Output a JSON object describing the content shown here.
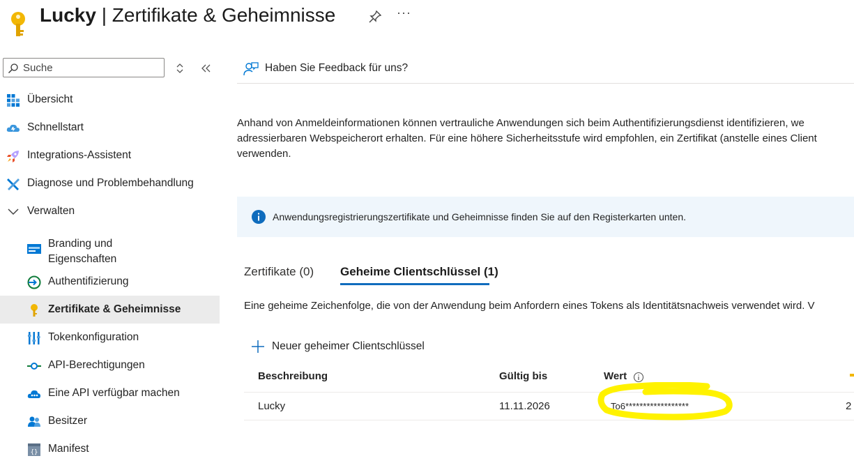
{
  "header": {
    "app_name": "Lucky",
    "separator": " | ",
    "page_title": "Zertifikate & Geheimnisse",
    "more_label": "···"
  },
  "sidebar": {
    "search_placeholder": "Suche",
    "items": [
      {
        "label": "Übersicht",
        "icon": "grid-icon"
      },
      {
        "label": "Schnellstart",
        "icon": "cloud-icon"
      },
      {
        "label": "Integrations-Assistent",
        "icon": "rocket-icon"
      },
      {
        "label": "Diagnose und Problembehandlung",
        "icon": "tools-icon"
      },
      {
        "label": "Verwalten",
        "icon": "chevron-down-icon"
      },
      {
        "label": "Branding und Eigenschaften",
        "icon": "branding-icon"
      },
      {
        "label": "Authentifizierung",
        "icon": "auth-icon"
      },
      {
        "label": "Zertifikate & Geheimnisse",
        "icon": "key-icon"
      },
      {
        "label": "Tokenkonfiguration",
        "icon": "token-icon"
      },
      {
        "label": "API-Berechtigungen",
        "icon": "api-permission-icon"
      },
      {
        "label": "Eine API verfügbar machen",
        "icon": "cloud-api-icon"
      },
      {
        "label": "Besitzer",
        "icon": "owners-icon"
      },
      {
        "label": "Manifest",
        "icon": "manifest-icon"
      }
    ]
  },
  "main": {
    "feedback_label": "Haben Sie Feedback für uns?",
    "description_lines": [
      "Anhand von Anmeldeinformationen können vertrauliche Anwendungen sich beim Authentifizierungsdienst identifizieren, we",
      "adressierbaren Webspeicherort erhalten. Für eine höhere Sicherheitsstufe wird empfohlen, ein Zertifikat (anstelle eines Client",
      "verwenden."
    ],
    "info_text": "Anwendungsregistrierungszertifikate und Geheimnisse finden Sie auf den Registerkarten unten.",
    "tabs": [
      {
        "label": "Zertifikate (0)"
      },
      {
        "label": "Geheime Clientschlüssel (1)"
      }
    ],
    "secret_description": "Eine geheime Zeichenfolge, die von der Anwendung beim Anfordern eines Tokens als Identitätsnachweis verwendet wird. V",
    "add_button_label": "Neuer geheimer Clientschlüssel",
    "table": {
      "headers": [
        "Beschreibung",
        "Gültig bis",
        "Wert"
      ],
      "rows": [
        {
          "description": "Lucky",
          "expires": "11.11.2026",
          "value": "To6******************",
          "extra": "2"
        }
      ]
    }
  },
  "colors": {
    "accent": "#0f6cbd",
    "info_bg": "#eff6fc",
    "active_bg": "#ebebeb",
    "highlight": "#fff200",
    "key": "#f2b705"
  }
}
